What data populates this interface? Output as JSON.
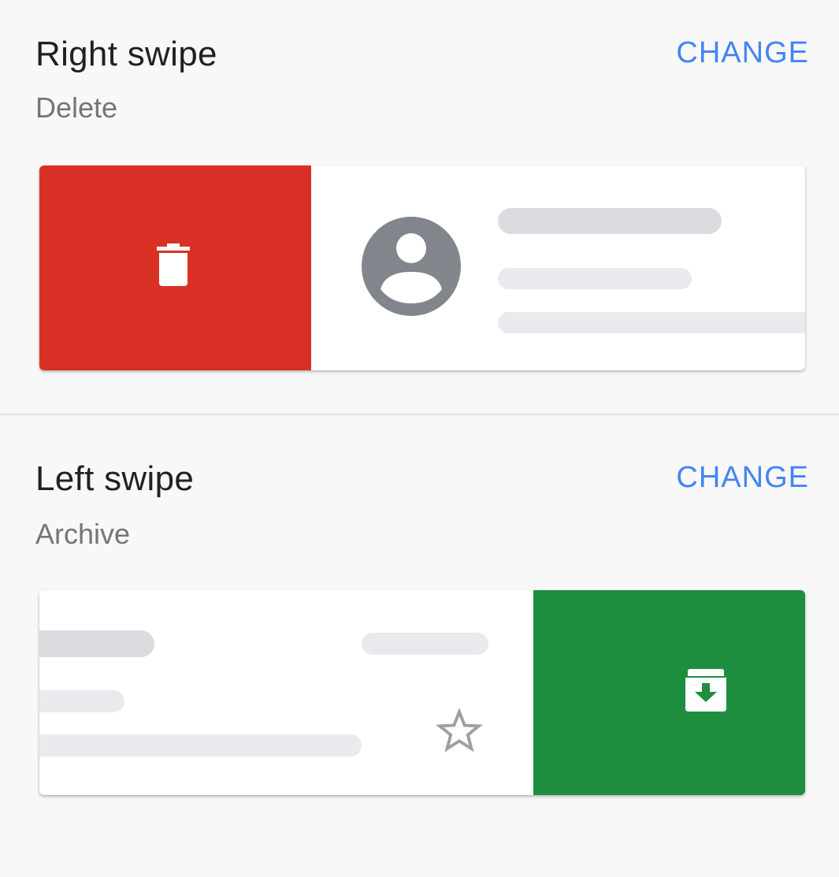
{
  "right_swipe": {
    "title": "Right swipe",
    "action": "Delete",
    "change_label": "CHANGE",
    "action_color": "#d93025",
    "action_icon": "trash-icon"
  },
  "left_swipe": {
    "title": "Left swipe",
    "action": "Archive",
    "change_label": "CHANGE",
    "action_color": "#1e8e3e",
    "action_icon": "archive-icon"
  },
  "colors": {
    "accent": "#4285f4",
    "placeholder_dark": "#dadce0",
    "placeholder_light": "#e8eaed",
    "avatar": "#80868b",
    "star": "#9e9e9e"
  },
  "icons": [
    "trash-icon",
    "avatar-icon",
    "star-icon",
    "archive-icon"
  ]
}
